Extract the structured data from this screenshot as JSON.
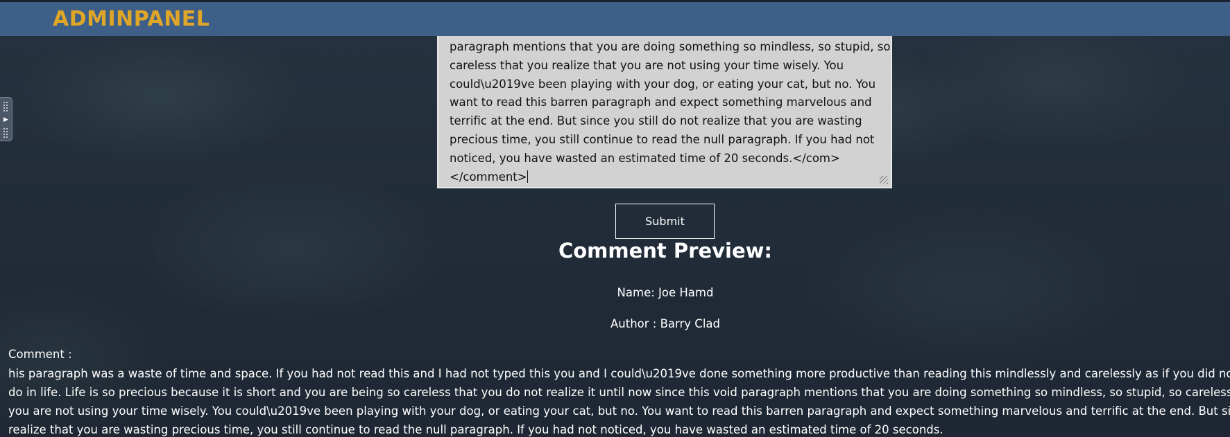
{
  "header": {
    "brand": "ADMINPANEL"
  },
  "side_handle": {
    "icon": "play-arrow-icon"
  },
  "comment_input": {
    "lines": [
      "paragraph mentions that you are doing something so mindless, so stupid, so",
      "careless that you realize that you are not using your time wisely. You",
      "could\\u2019ve been playing with your dog, or eating your cat, but no. You",
      "want to read this barren paragraph and expect something marvelous and",
      "terrific at the end. But since you still do not realize that you are wasting",
      "precious time, you still continue to read the null paragraph. If you had not",
      "noticed, you have wasted an estimated time of 20 seconds.</com>",
      "</comment>"
    ]
  },
  "form": {
    "submit_label": "Submit"
  },
  "preview": {
    "title": "Comment Preview:",
    "name": "Name: Joe Hamd",
    "author": "Author : Barry Clad",
    "comment_label": "Comment :",
    "comment_lines": [
      "his paragraph was a waste of time and space. If you had not read this and I had not typed this you and I could\\u2019ve done something more productive than reading this mindlessly and carelessly as if you did not have anything else to",
      "do in life. Life is so precious because it is short and you are being so careless that you do not realize it until now since this void paragraph mentions that you are doing something so mindless, so stupid, so careless that you realize that",
      "you are not using your time wisely. You could\\u2019ve been playing with your dog, or eating your cat, but no. You want to read this barren paragraph and expect something marvelous and terrific at the end. But since you still do not",
      "realize that you are wasting precious time, you still continue to read the null paragraph. If you had not noticed, you have wasted an estimated time of 20 seconds."
    ]
  },
  "colors": {
    "header_bg": "#3e5f88",
    "brand": "#e0a628",
    "page_bg": "#222c38",
    "textarea_bg": "#d2d2d2"
  }
}
